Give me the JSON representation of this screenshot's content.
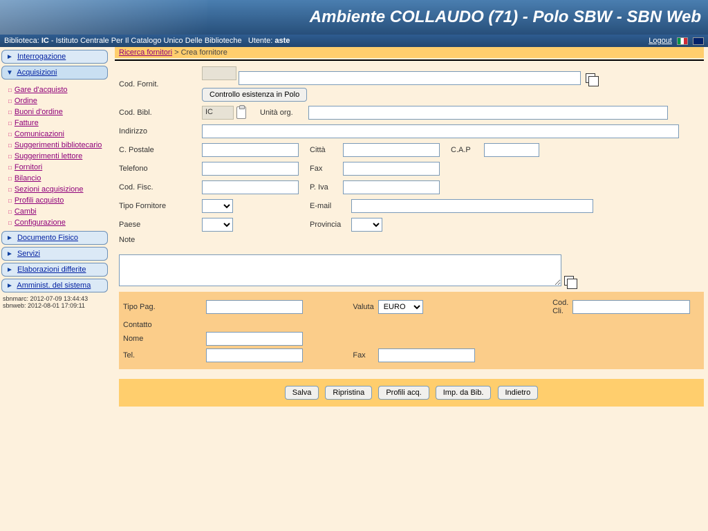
{
  "header": {
    "title": "Ambiente COLLAUDO (71) - Polo SBW - SBN Web"
  },
  "topbar": {
    "biblioteca_label": "Biblioteca:",
    "biblioteca_code": "IC",
    "biblioteca_name": "- Istituto Centrale Per Il Catalogo Unico Delle Biblioteche",
    "utente_label": "Utente:",
    "utente_value": "aste",
    "logout": "Logout"
  },
  "menu": {
    "interrogazione": "Interrogazione",
    "acquisizioni": "Acquisizioni",
    "sub": {
      "gare": "Gare d'acquisto",
      "ordine": "Ordine",
      "buoni": "Buoni d'ordine",
      "fatture": "Fatture",
      "comunicazioni": "Comunicazioni",
      "sugg_biblio": "Suggerimenti bibliotecario",
      "sugg_lettore": "Suggerimenti lettore",
      "fornitori": "Fornitori",
      "bilancio": "Bilancio",
      "sezioni": "Sezioni acquisizione",
      "profili": "Profili acquisto",
      "cambi": "Cambi",
      "config": "Configurazione"
    },
    "documento": "Documento Fisico",
    "servizi": "Servizi",
    "elaborazioni": "Elaborazioni differite",
    "amminist": "Amminist. del sistema"
  },
  "timestamps": {
    "sbnmarc": "sbnmarc: 2012-07-09 13:44:43",
    "sbnweb": "sbnweb:  2012-08-01 17:09:11"
  },
  "breadcrumb": {
    "link": "Ricerca fornitori",
    "sep": " > ",
    "current": "Crea fornitore"
  },
  "form": {
    "cod_fornit": "Cod. Fornit.",
    "controllo_btn": "Controllo esistenza in Polo",
    "cod_bibl": "Cod. Bibl.",
    "cod_bibl_val": "IC",
    "unita_org": "Unità org.",
    "indirizzo": "Indirizzo",
    "cpostale": "C. Postale",
    "citta": "Città",
    "cap": "C.A.P",
    "telefono": "Telefono",
    "fax": "Fax",
    "cod_fisc": "Cod. Fisc.",
    "piva": "P. Iva",
    "tipo_fornitore": "Tipo Fornitore",
    "email": "E-mail",
    "paese": "Paese",
    "provincia": "Provincia",
    "note": "Note",
    "tipo_pag": "Tipo Pag.",
    "valuta": "Valuta",
    "valuta_val": "EURO",
    "cod_cli": "Cod. Cli.",
    "contatto": "Contatto",
    "nome": "Nome",
    "tel": "Tel.",
    "fax2": "Fax"
  },
  "buttons": {
    "salva": "Salva",
    "ripristina": "Ripristina",
    "profili": "Profili acq.",
    "imp": "Imp. da Bib.",
    "indietro": "Indietro"
  }
}
